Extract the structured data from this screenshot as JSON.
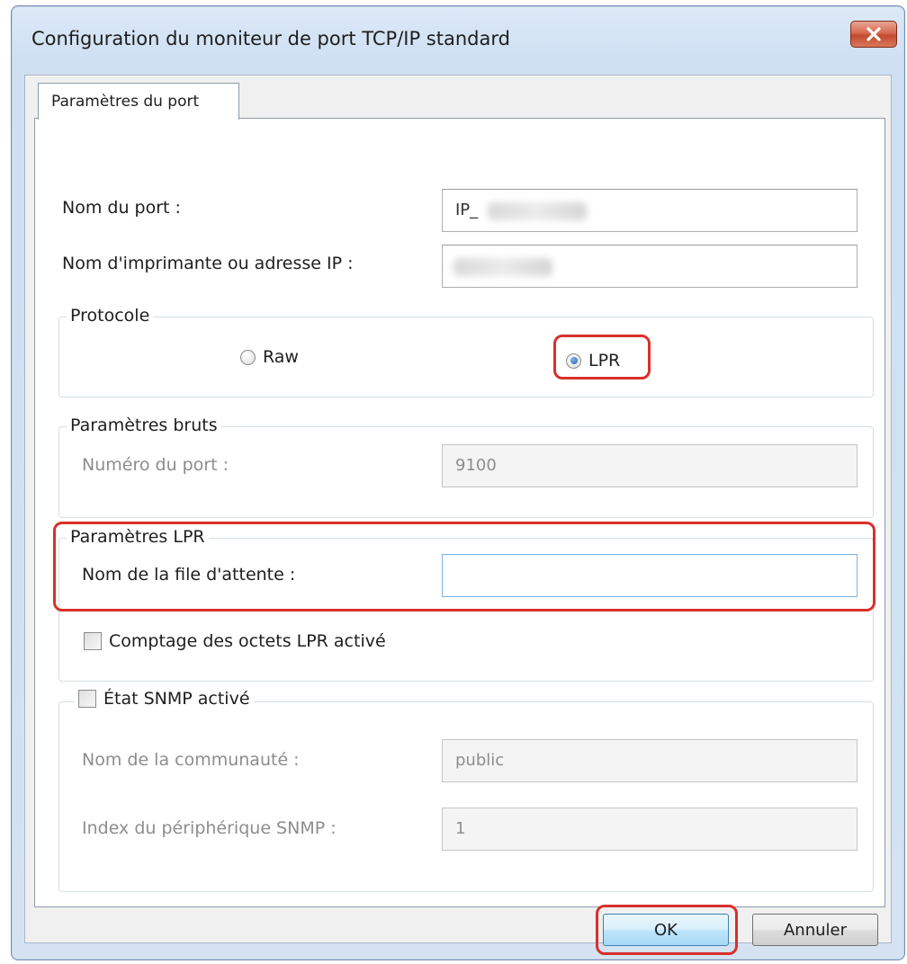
{
  "window": {
    "title": "Configuration du moniteur de port TCP/IP standard"
  },
  "tabs": [
    {
      "label": "Paramètres du port",
      "selected": true
    }
  ],
  "port": {
    "name_label": "Nom du port :",
    "name_value": "IP_",
    "printer_label": "Nom d'imprimante ou adresse IP :",
    "printer_value": ""
  },
  "protocol": {
    "legend": "Protocole",
    "raw_label": "Raw",
    "lpr_label": "LPR",
    "selected": "LPR"
  },
  "raw_settings": {
    "legend": "Paramètres bruts",
    "port_number_label": "Numéro du port :",
    "port_number_value": "9100"
  },
  "lpr_settings": {
    "legend": "Paramètres LPR",
    "queue_label": "Nom de la file d'attente :",
    "queue_value": "",
    "byte_count_label": "Comptage des octets LPR activé",
    "byte_count_checked": false
  },
  "snmp": {
    "status_label": "État SNMP activé",
    "status_checked": false,
    "community_label": "Nom de la communauté :",
    "community_value": "public",
    "device_index_label": "Index du périphérique SNMP :",
    "device_index_value": "1"
  },
  "buttons": {
    "ok": "OK",
    "cancel": "Annuler"
  },
  "colors": {
    "highlight": "#d9302c",
    "disabled_text": "#8d8d8d"
  }
}
